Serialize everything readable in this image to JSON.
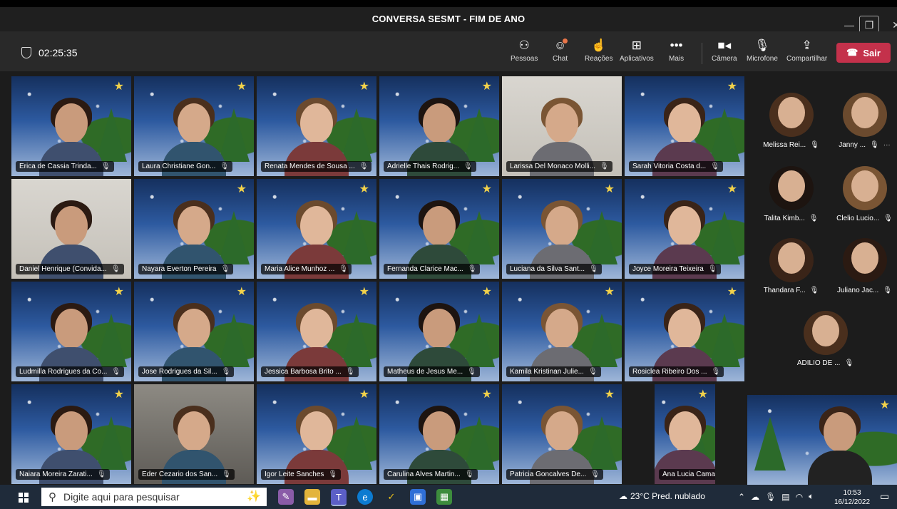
{
  "window": {
    "title": "CONVERSA SESMT - FIM DE ANO",
    "min_glyph": "—",
    "max_glyph": "❐",
    "close_glyph": "✕"
  },
  "toolbar": {
    "timer": "02:25:35",
    "items": {
      "people": "Pessoas",
      "chat": "Chat",
      "reactions": "Reações",
      "apps": "Aplicativos",
      "more": "Mais",
      "camera": "Câmera",
      "microphone": "Microfone",
      "share": "Compartilhar"
    },
    "leave": "Sair"
  },
  "tiles": [
    {
      "name": "Erica de Cassia Trinda...",
      "bg": "xmas"
    },
    {
      "name": "Laura Christiane Gon...",
      "bg": "xmas"
    },
    {
      "name": "Renata Mendes de Sousa ...",
      "bg": "xmas"
    },
    {
      "name": "Adrielle Thais Rodrig...",
      "bg": "xmas"
    },
    {
      "name": "Larissa Del Monaco Molli...",
      "bg": "room"
    },
    {
      "name": "Sarah Vitoria Costa d...",
      "bg": "xmas"
    },
    {
      "name": "Daniel Henrique (Convida...",
      "bg": "room"
    },
    {
      "name": "Nayara Everton Pereira",
      "bg": "xmas"
    },
    {
      "name": "Maria Alice Munhoz ...",
      "bg": "xmas"
    },
    {
      "name": "Fernanda Clarice Mac...",
      "bg": "xmas"
    },
    {
      "name": "Luciana da Silva Sant...",
      "bg": "xmas"
    },
    {
      "name": "Joyce Moreira Teixeira",
      "bg": "xmas"
    },
    {
      "name": "Ludmilla Rodrigues da Co...",
      "bg": "xmas"
    },
    {
      "name": "Jose Rodrigues da Sil...",
      "bg": "xmas"
    },
    {
      "name": "Jessica Barbosa Brito ...",
      "bg": "xmas"
    },
    {
      "name": "Matheus de Jesus Me...",
      "bg": "xmas"
    },
    {
      "name": "Kamila Kristinan Julie...",
      "bg": "xmas"
    },
    {
      "name": "Rosiclea Ribeiro Dos ...",
      "bg": "xmas"
    },
    {
      "name": "Naiara Moreira Zarati...",
      "bg": "xmas"
    },
    {
      "name": "Eder Cezario dos San...",
      "bg": "office"
    },
    {
      "name": "Igor Leite Sanches",
      "bg": "xmas"
    },
    {
      "name": "Carulina Alves Martin...",
      "bg": "xmas"
    },
    {
      "name": "Patricia Goncalves De...",
      "bg": "xmas"
    },
    {
      "name": "Ana Lucia Camara Be...",
      "bg": "xmas"
    }
  ],
  "rail": [
    {
      "name": "Melissa Rei..."
    },
    {
      "name": "Janny ..."
    },
    {
      "name": "Talita Kimb..."
    },
    {
      "name": "Clelio Lucio..."
    },
    {
      "name": "Thandara F..."
    },
    {
      "name": "Juliano Jac..."
    },
    {
      "name": "ADILIO DE ..."
    }
  ],
  "taskbar": {
    "search_placeholder": "Digite aqui para pesquisar",
    "weather": "23°C  Pred. nublado",
    "time": "10:53",
    "date": "16/12/2022"
  }
}
